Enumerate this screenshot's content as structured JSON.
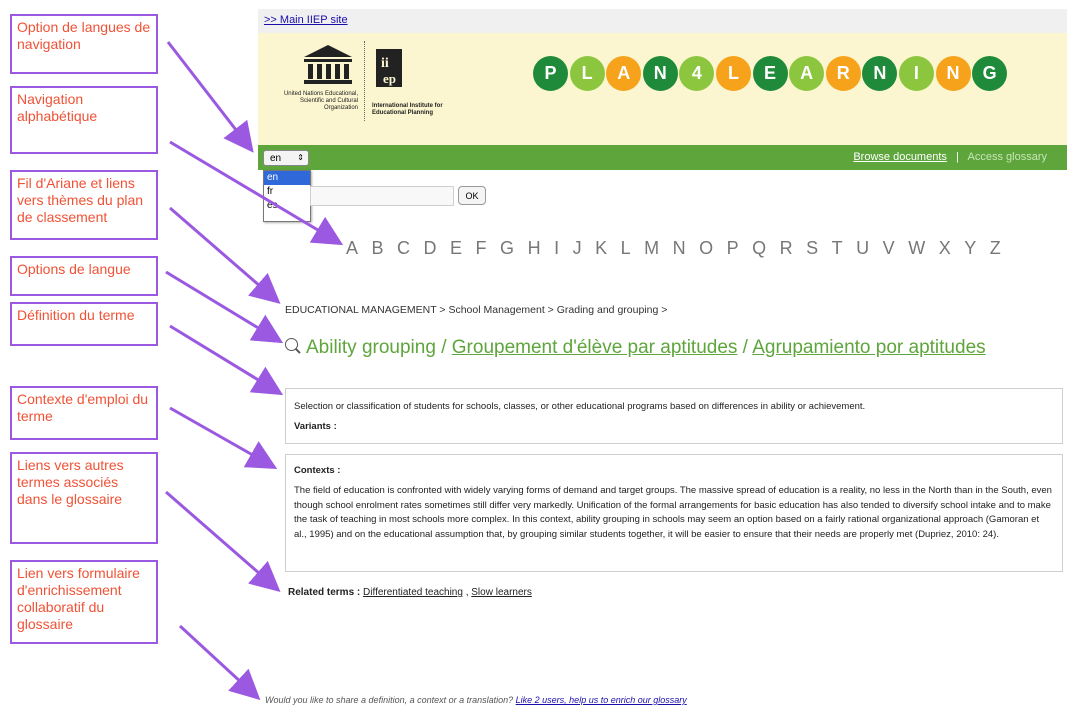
{
  "annotations": [
    {
      "text": "Option de langues de navigation"
    },
    {
      "text": "Navigation alphabétique"
    },
    {
      "text": "Fil d'Ariane et liens vers thèmes du plan de classement"
    },
    {
      "text": "Options de langue"
    },
    {
      "text": "Définition du terme"
    },
    {
      "text": "Contexte d'emploi du terme"
    },
    {
      "text": "Liens vers autres termes associés dans le glossaire"
    },
    {
      "text": "Lien vers formulaire d'enrichissement collaboratif du glossaire"
    }
  ],
  "topbar": {
    "link": ">> Main IIEP site"
  },
  "header": {
    "unesco_name": "United Nations Educational, Scientific and Cultural Organization",
    "iiep_name": "International Institute for Educational Planning",
    "logo_letters": [
      "P",
      "L",
      "A",
      "N",
      "4",
      "L",
      "E",
      "A",
      "R",
      "N",
      "I",
      "N",
      "G"
    ],
    "logo_colors": [
      "#1f8a3a",
      "#8cc63f",
      "#f7a21b",
      "#1f8a3a",
      "#8cc63f",
      "#f7a21b",
      "#1f8a3a",
      "#8cc63f",
      "#f7a21b",
      "#1f8a3a",
      "#8cc63f",
      "#f7a21b",
      "#1f8a3a"
    ]
  },
  "nav": {
    "lang_selected": "en",
    "lang_options": [
      "en",
      "fr",
      "es"
    ],
    "browse": "Browse documents",
    "separator": "|",
    "access": "Access glossary"
  },
  "search": {
    "ok": "OK"
  },
  "alphabet": [
    "A",
    "B",
    "C",
    "D",
    "E",
    "F",
    "G",
    "H",
    "I",
    "J",
    "K",
    "L",
    "M",
    "N",
    "O",
    "P",
    "Q",
    "R",
    "S",
    "T",
    "U",
    "V",
    "W",
    "X",
    "Y",
    "Z"
  ],
  "breadcrumb": "EDUCATIONAL MANAGEMENT > School Management > Grading and grouping >",
  "term": {
    "en": "Ability grouping",
    "sep1": " / ",
    "fr": "Groupement d'élève par aptitudes",
    "sep2": " / ",
    "es": "Agrupamiento por aptitudes"
  },
  "definition": {
    "text": "Selection or classification of students for schools, classes, or other educational programs based on differences in ability or achievement.",
    "variants_label": "Variants :"
  },
  "contexts": {
    "label": "Contexts :",
    "text": "The field of education is confronted with widely varying forms of demand and target groups. The massive spread of education is a reality, no less in the North than in the South, even though school enrolment rates sometimes still differ very markedly. Unification of the formal arrangements for basic education has also tended to diversify school intake and to make the task of teaching in most schools more complex. In this context, ability grouping in schools may seem an option based on a fairly rational organizational approach (Gamoran et al., 1995) and on the educational assumption that, by grouping similar students together, it will be easier to ensure that their needs are properly met (Dupriez, 2010: 24)."
  },
  "related": {
    "label": "Related terms :",
    "terms": [
      "Differentiated teaching",
      "Slow learners"
    ],
    "sep": " , "
  },
  "footer": {
    "question": "Would you like to share a definition, a context or a translation? ",
    "link": "Like 2 users, help us to enrich our glossary"
  },
  "colors": {
    "accent_green": "#5ea53b",
    "callout_border": "#9a59e0",
    "callout_text": "#f05236"
  }
}
